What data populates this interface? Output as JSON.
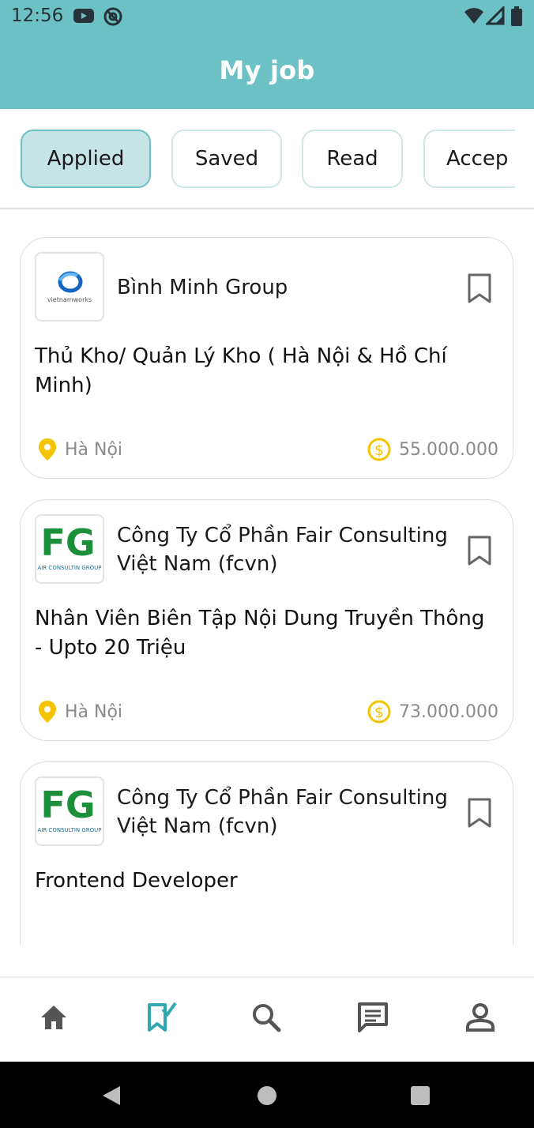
{
  "status_bar": {
    "time": "12:56",
    "left_icons": [
      "youtube-icon",
      "at-sign-icon"
    ],
    "right_icons": [
      "wifi-icon",
      "signal-icon",
      "battery-icon"
    ]
  },
  "app_bar": {
    "title": "My job"
  },
  "tabs": [
    {
      "label": "Applied",
      "active": true
    },
    {
      "label": "Saved",
      "active": false
    },
    {
      "label": "Read",
      "active": false
    },
    {
      "label": "Accep",
      "active": false
    }
  ],
  "jobs": [
    {
      "company": "Bình Minh Group",
      "logo_text": "vietnamworks",
      "title": "Thủ Kho/ Quản Lý Kho ( Hà Nội & Hồ Chí Minh)",
      "location": "Hà Nội",
      "salary": "55.000.000"
    },
    {
      "company": "Công Ty Cổ Phần Fair Consulting Việt Nam (fcvn)",
      "logo_text": "AIR CONSULTIN GROUP",
      "logo_mark": "FG",
      "title": "Nhân Viên Biên Tập Nội Dung Truyền Thông - Upto 20 Triệu",
      "location": "Hà Nội",
      "salary": "73.000.000"
    },
    {
      "company": "Công Ty Cổ Phần Fair Consulting Việt Nam (fcvn)",
      "logo_text": "AIR CONSULTIN GROUP",
      "logo_mark": "FG",
      "title": "Frontend Developer"
    }
  ],
  "bottom_nav": [
    {
      "icon": "home-icon",
      "active": false
    },
    {
      "icon": "bookmark-check-icon",
      "active": true
    },
    {
      "icon": "search-icon",
      "active": false
    },
    {
      "icon": "chat-icon",
      "active": false
    },
    {
      "icon": "profile-icon",
      "active": false
    }
  ],
  "colors": {
    "primary": "#6cc1c5",
    "tab_active_bg": "#c6e4e6",
    "location_pin": "#f5c400",
    "salary_coin": "#f5c400",
    "icon_gray": "#555555"
  }
}
